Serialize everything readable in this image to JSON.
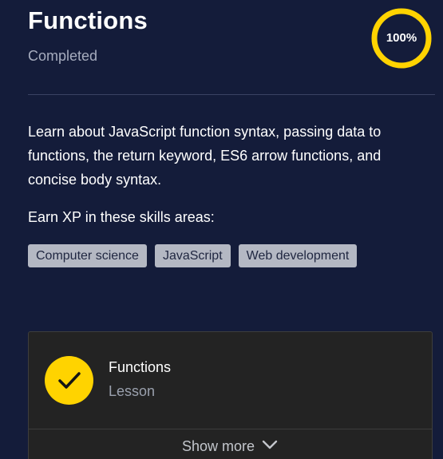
{
  "header": {
    "title": "Functions",
    "status": "Completed",
    "progress_label": "100%",
    "progress_fraction": 1.0,
    "progress_color": "#ffd300"
  },
  "description": "Learn about JavaScript function syntax, passing data to functions, the return keyword, ES6 arrow functions, and concise body syntax.",
  "skills": {
    "heading": "Earn XP in these skills areas:",
    "tags": [
      "Computer science",
      "JavaScript",
      "Web development"
    ]
  },
  "lesson": {
    "title": "Functions",
    "type": "Lesson",
    "icon": "checkmark-icon",
    "icon_color": "#ffd300"
  },
  "show_more": {
    "label": "Show more",
    "icon": "chevron-down-icon"
  }
}
